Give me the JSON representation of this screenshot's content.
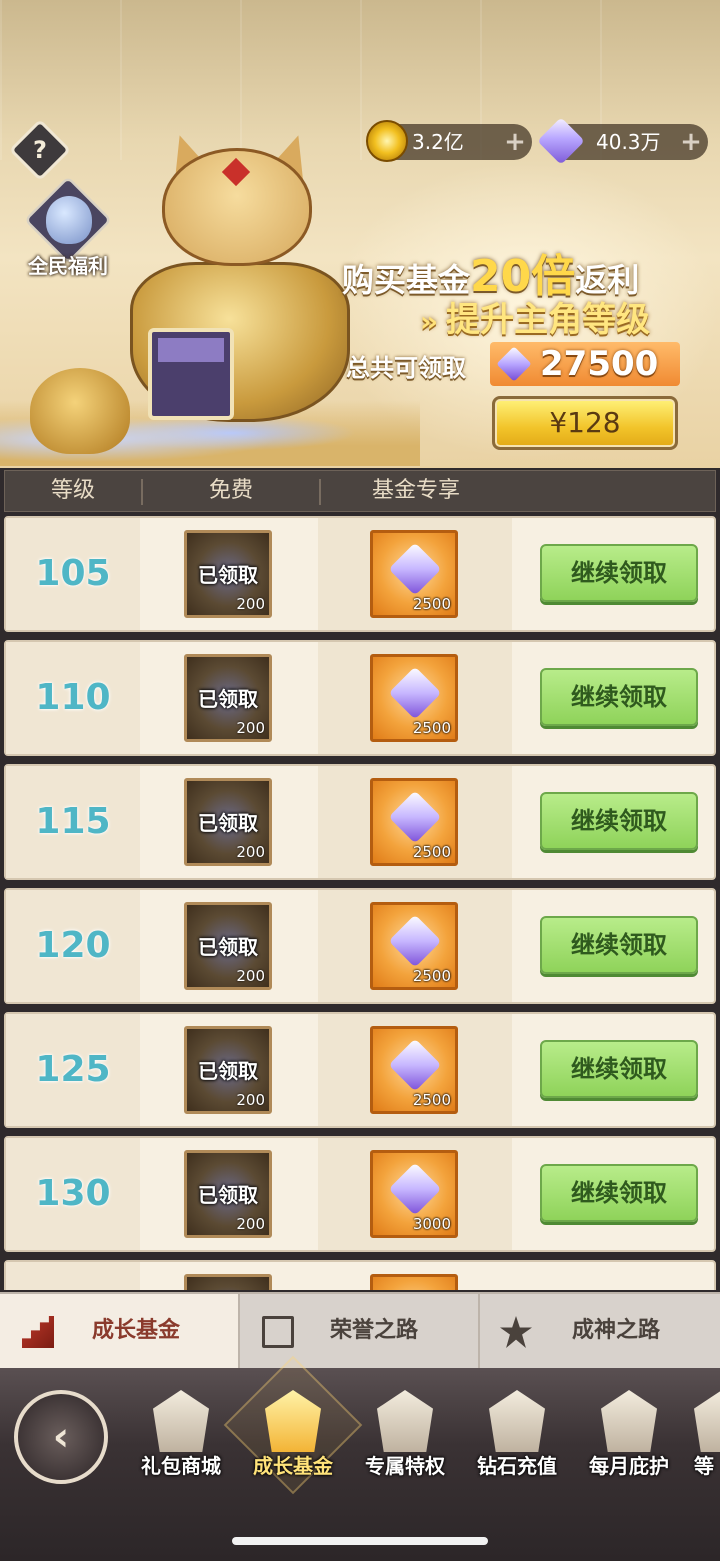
{
  "header": {
    "help_label": "?",
    "welfare_label": "全民福利",
    "currencies": [
      {
        "icon": "gold-coin-icon",
        "value": "3.2亿"
      },
      {
        "icon": "diamond-icon",
        "value": "40.3万"
      }
    ],
    "plus_label": "+"
  },
  "promo": {
    "line1_pre": "购买基金",
    "line1_big": "20倍",
    "line1_post": "返利",
    "line2_chevron": "»",
    "line2": "提升主角等级",
    "total_label": "总共可领取",
    "total_value": "27500",
    "buy_price": "¥128"
  },
  "table": {
    "headers": [
      "等级",
      "免费",
      "基金专享"
    ],
    "claimed_label": "已领取",
    "claim_button_label": "继续领取",
    "rows": [
      {
        "level": "105",
        "free_count": "200",
        "fund_count": "2500"
      },
      {
        "level": "110",
        "free_count": "200",
        "fund_count": "2500"
      },
      {
        "level": "115",
        "free_count": "200",
        "fund_count": "2500"
      },
      {
        "level": "120",
        "free_count": "200",
        "fund_count": "2500"
      },
      {
        "level": "125",
        "free_count": "200",
        "fund_count": "2500"
      },
      {
        "level": "130",
        "free_count": "200",
        "fund_count": "3000"
      }
    ]
  },
  "subtabs": [
    {
      "label": "成长基金",
      "icon": "growth-chart-icon",
      "active": true
    },
    {
      "label": "荣誉之路",
      "icon": "honor-frame-icon",
      "active": false
    },
    {
      "label": "成神之路",
      "icon": "star-emblem-icon",
      "active": false
    }
  ],
  "nav": {
    "back_icon": "back-arrow-icon",
    "back_glyph": "‹",
    "items": [
      {
        "label": "礼包商城",
        "icon": "gift-shop-icon",
        "active": false
      },
      {
        "label": "成长基金",
        "icon": "growth-fund-icon",
        "active": true
      },
      {
        "label": "专属特权",
        "icon": "privilege-crest-icon",
        "active": false
      },
      {
        "label": "钻石充值",
        "icon": "diamond-recharge-icon",
        "active": false
      },
      {
        "label": "每月庇护",
        "icon": "monthly-shield-icon",
        "active": false
      },
      {
        "label": "等",
        "icon": "more-icon",
        "active": false
      }
    ]
  },
  "colors": {
    "accent_gold": "#ffd84a",
    "level_text": "#4fb6c6",
    "claim_green": "#8fd35a",
    "fund_orange": "#f3a33c"
  }
}
